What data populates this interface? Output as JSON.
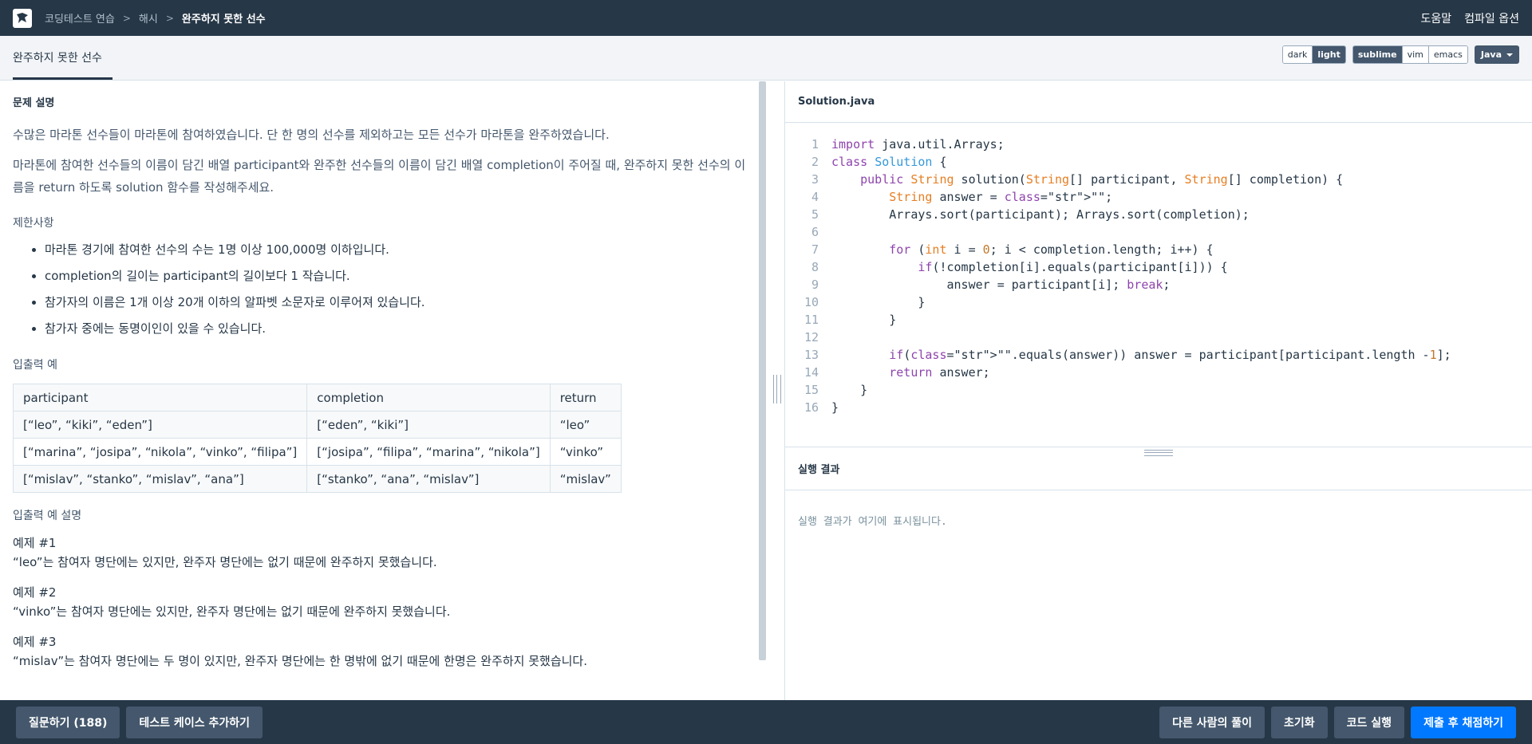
{
  "nav": {
    "breadcrumb": [
      "코딩테스트 연습",
      "해시",
      "완주하지 못한 선수"
    ],
    "help": "도움말",
    "compile_options": "컴파일 옵션"
  },
  "tab": {
    "title": "완주하지 못한 선수"
  },
  "theme": {
    "dark": "dark",
    "light": "light",
    "selected": "light"
  },
  "keymap": {
    "sublime": "sublime",
    "vim": "vim",
    "emacs": "emacs",
    "selected": "sublime"
  },
  "language": "Java",
  "problem": {
    "heading": "문제 설명",
    "p1": "수많은 마라톤 선수들이 마라톤에 참여하였습니다. 단 한 명의 선수를 제외하고는 모든 선수가 마라톤을 완주하였습니다.",
    "p2": "마라톤에 참여한 선수들의 이름이 담긴 배열 participant와 완주한 선수들의 이름이 담긴 배열 completion이 주어질 때, 완주하지 못한 선수의 이름을 return 하도록 solution 함수를 작성해주세요.",
    "constraints_title": "제한사항",
    "constraints": [
      "마라톤 경기에 참여한 선수의 수는 1명 이상 100,000명 이하입니다.",
      "completion의 길이는 participant의 길이보다 1 작습니다.",
      "참가자의 이름은 1개 이상 20개 이하의 알파벳 소문자로 이루어져 있습니다.",
      "참가자 중에는 동명이인이 있을 수 있습니다."
    ],
    "io_title": "입출력 예",
    "io_headers": [
      "participant",
      "completion",
      "return"
    ],
    "io_rows": [
      [
        "[“leo”, “kiki”, “eden”]",
        "[“eden”, “kiki”]",
        "“leo”"
      ],
      [
        "[“marina”, “josipa”, “nikola”, “vinko”, “filipa”]",
        "[“josipa”, “filipa”, “marina”, “nikola”]",
        "“vinko”"
      ],
      [
        "[“mislav”, “stanko”, “mislav”, “ana”]",
        "[“stanko”, “ana”, “mislav”]",
        "“mislav”"
      ]
    ],
    "io_explain_title": "입출력 예 설명",
    "examples": [
      {
        "label": "예제 #1",
        "text": "“leo”는 참여자 명단에는 있지만, 완주자 명단에는 없기 때문에 완주하지 못했습니다."
      },
      {
        "label": "예제 #2",
        "text": "“vinko”는 참여자 명단에는 있지만, 완주자 명단에는 없기 때문에 완주하지 못했습니다."
      },
      {
        "label": "예제 #3",
        "text": "“mislav”는 참여자 명단에는 두 명이 있지만, 완주자 명단에는 한 명밖에 없기 때문에 한명은 완주하지 못했습니다."
      }
    ]
  },
  "editor": {
    "filename": "Solution.java",
    "line_numbers": [
      "1",
      "2",
      "3",
      "4",
      "5",
      "6",
      "7",
      "8",
      "9",
      "10",
      "11",
      "12",
      "13",
      "14",
      "15",
      "16"
    ],
    "lines": [
      "import java.util.Arrays;",
      "class Solution {",
      "    public String solution(String[] participant, String[] completion) {",
      "        String answer = \"\";",
      "        Arrays.sort(participant); Arrays.sort(completion);",
      "",
      "        for (int i = 0; i < completion.length; i++) {",
      "            if(!completion[i].equals(participant[i])) {",
      "                answer = participant[i]; break;",
      "            }",
      "        }",
      "",
      "        if(\"\".equals(answer)) answer = participant[participant.length -1];",
      "        return answer;",
      "    }",
      "}"
    ]
  },
  "result": {
    "title": "실행 결과",
    "placeholder": "실행 결과가 여기에 표시됩니다."
  },
  "bottom": {
    "ask": "질문하기 (188)",
    "add_testcase": "테스트 케이스 추가하기",
    "others_solutions": "다른 사람의 풀이",
    "reset": "초기화",
    "run": "코드 실행",
    "submit": "제출 후 채점하기"
  },
  "colors": {
    "nav_bg": "#263747",
    "accent": "#0078ff",
    "button_bg": "#44576c"
  }
}
